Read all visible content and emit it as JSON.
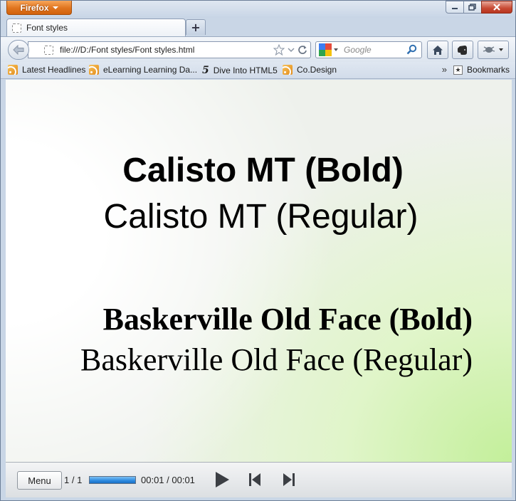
{
  "browser": {
    "app_button": "Firefox",
    "tab_title": "Font styles",
    "url": "file:///D:/Font styles/Font styles.html",
    "search_placeholder": "Google",
    "new_tab": "+"
  },
  "bookmarks_bar": {
    "items": [
      {
        "label": "Latest Headlines",
        "icon": "rss-feed-icon"
      },
      {
        "label": "eLearning Learning Da...",
        "icon": "rss-feed-icon"
      },
      {
        "label": "Dive Into HTML5",
        "icon": "html5-icon"
      },
      {
        "label": "Co.Design",
        "icon": "rss-feed-icon"
      }
    ],
    "overflow": "»",
    "bookmarks_menu": "Bookmarks"
  },
  "slide": {
    "calisto_bold": "Calisto MT (Bold)",
    "calisto_regular": "Calisto MT (Regular)",
    "baskerville_bold": "Baskerville Old Face (Bold)",
    "baskerville_regular": "Baskerville Old Face (Regular)"
  },
  "player": {
    "menu_label": "Menu",
    "slide_counter": "1 / 1",
    "progress_fraction": 1.0,
    "time": "00:01 / 00:01"
  },
  "colors": {
    "firefox_orange": "#e0741e",
    "progress_blue": "#2c8ae0",
    "slide_green": "#c3ef9a"
  }
}
